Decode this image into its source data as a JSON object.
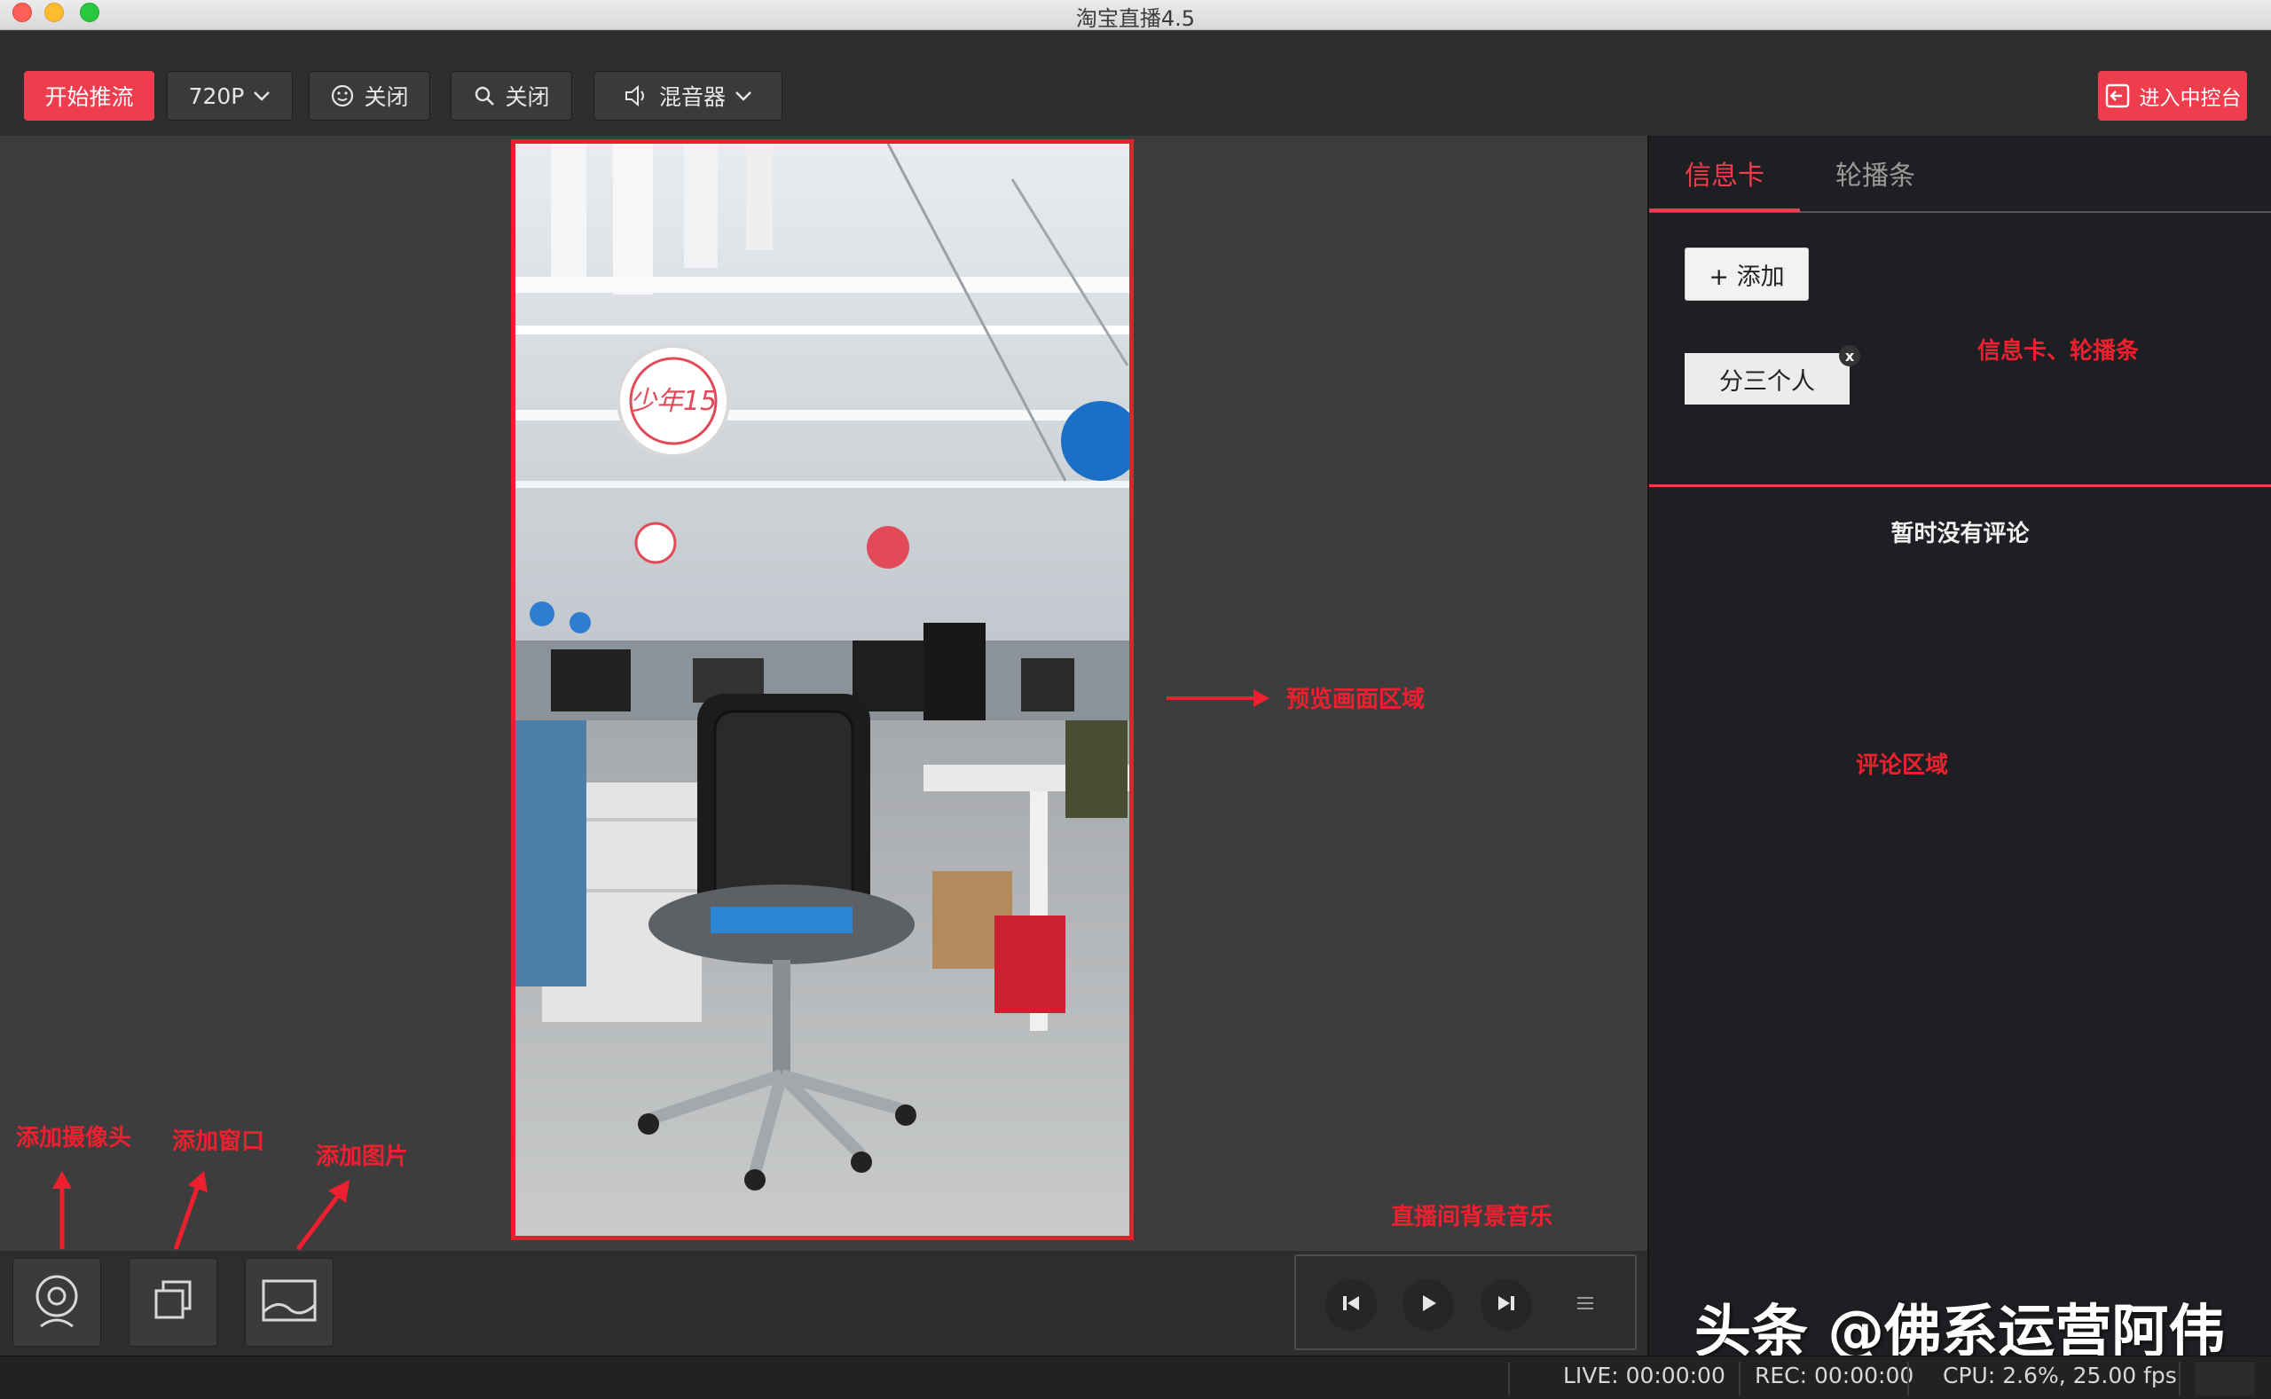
{
  "window": {
    "title": "淘宝直播4.5"
  },
  "toolbar": {
    "start_stream": "开始推流",
    "resolution": "720P",
    "beauty_label": "关闭",
    "filter_label": "关闭",
    "mixer_label": "混音器",
    "console_label": "进入中控台"
  },
  "tabs": [
    {
      "label": "信息卡"
    },
    {
      "label": "轮播条"
    }
  ],
  "panel": {
    "add_button": "+ 添加",
    "info_card": "分三个人",
    "card_close": "x",
    "no_comments": "暂时没有评论"
  },
  "annotations": {
    "preview_area": "预览画面区域",
    "cards_area": "信息卡、轮播条",
    "comment_area": "评论区域",
    "add_camera": "添加摄像头",
    "add_window": "添加窗口",
    "add_image": "添加图片",
    "bg_music": "直播间背景音乐"
  },
  "status": {
    "live": "LIVE: 00:00:00",
    "rec": "REC: 00:00:00",
    "cpu": "CPU: 2.6%, 25.00 fps"
  },
  "watermark": "头条 @佛系运营阿伟",
  "colors": {
    "accent": "#ee3d4c",
    "annotation": "#ee2030"
  }
}
